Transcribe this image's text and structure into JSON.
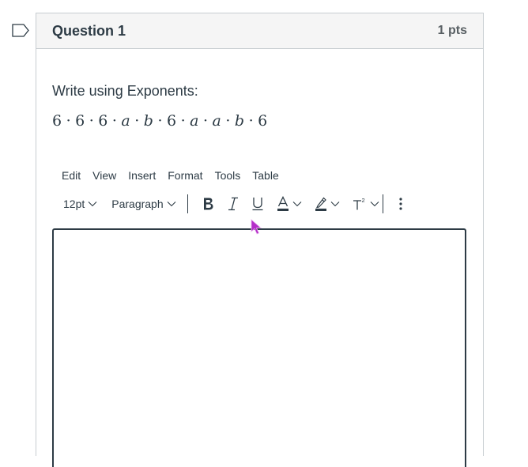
{
  "question": {
    "title": "Question 1",
    "points": "1 pts",
    "prompt": "Write using Exponents:",
    "expression": [
      {
        "t": "6",
        "v": false
      },
      {
        "t": "·",
        "v": false
      },
      {
        "t": "6",
        "v": false
      },
      {
        "t": "·",
        "v": false
      },
      {
        "t": "6",
        "v": false
      },
      {
        "t": "·",
        "v": false
      },
      {
        "t": "a",
        "v": true
      },
      {
        "t": "·",
        "v": false
      },
      {
        "t": "b",
        "v": true
      },
      {
        "t": "·",
        "v": false
      },
      {
        "t": "6",
        "v": false
      },
      {
        "t": "·",
        "v": false
      },
      {
        "t": "a",
        "v": true
      },
      {
        "t": "·",
        "v": false
      },
      {
        "t": "a",
        "v": true
      },
      {
        "t": "·",
        "v": false
      },
      {
        "t": "b",
        "v": true
      },
      {
        "t": "·",
        "v": false
      },
      {
        "t": "6",
        "v": false
      }
    ]
  },
  "editor": {
    "menu": [
      "Edit",
      "View",
      "Insert",
      "Format",
      "Tools",
      "Table"
    ],
    "font_size": "12pt",
    "block_format": "Paragraph",
    "content": "",
    "icons": {
      "flag": "flag-outline-icon",
      "bold": "bold-icon",
      "italic": "italic-icon",
      "underline": "underline-icon",
      "text_color": "text-color-icon",
      "highlight": "highlight-icon",
      "superscript": "superscript-icon",
      "more": "more-vertical-icon"
    },
    "colors": {
      "text": "#2d3b45",
      "border": "#c7cdd1",
      "header_bg": "#f5f5f5",
      "cursor": "#b42fc8"
    }
  }
}
